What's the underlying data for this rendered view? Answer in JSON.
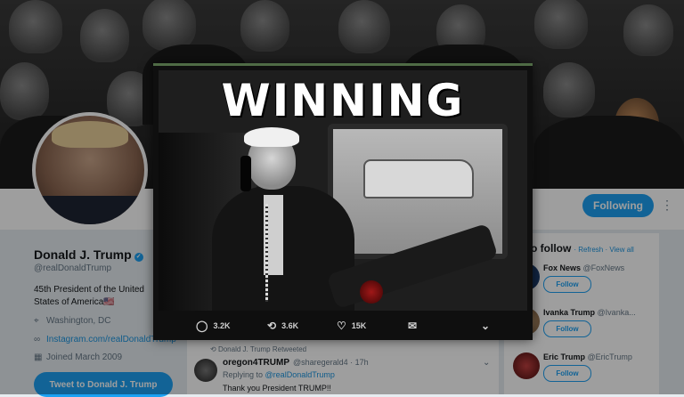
{
  "profile": {
    "name": "Donald J. Trump",
    "verified_mark": "✓",
    "handle": "@realDonaldTrump",
    "bio": "45th President of the United States of America🇺🇸",
    "location": "Washington, DC",
    "website": "Instagram.com/realDonaldTrump",
    "joined": "Joined March 2009",
    "following_button": "Following",
    "tweet_to_button": "Tweet to Donald J. Trump"
  },
  "who_to_follow": {
    "title": "o follow",
    "refresh": "· Refresh · View all",
    "follow_label": "Follow",
    "items": [
      {
        "name": "Fox News",
        "handle": "@FoxNews"
      },
      {
        "name": "Ivanka Trump",
        "handle": "@Ivanka..."
      },
      {
        "name": "Eric Trump",
        "handle": "@EricTrump"
      }
    ]
  },
  "timeline_tweet": {
    "retweet_note": "Donald J. Trump Retweeted",
    "author": "oregon4TRUMP",
    "author_handle": "@sharegerald4 · 17h",
    "replying_to_prefix": "Replying to",
    "replying_to_handle": "@realDonaldTrump",
    "text": "Thank you President TRUMP!!"
  },
  "modal": {
    "image_caption_text": "WINNING",
    "replies": "3.2K",
    "retweets": "3.6K",
    "likes": "15K"
  },
  "colors": {
    "accent": "#1da1f2",
    "modal_top_bar": "#4f6b45"
  },
  "icons": [
    "map-pin-icon",
    "link-icon",
    "calendar-icon",
    "reply-icon",
    "retweet-icon",
    "heart-icon",
    "message-icon",
    "chevron-down-icon",
    "verified-icon",
    "more-icon"
  ]
}
